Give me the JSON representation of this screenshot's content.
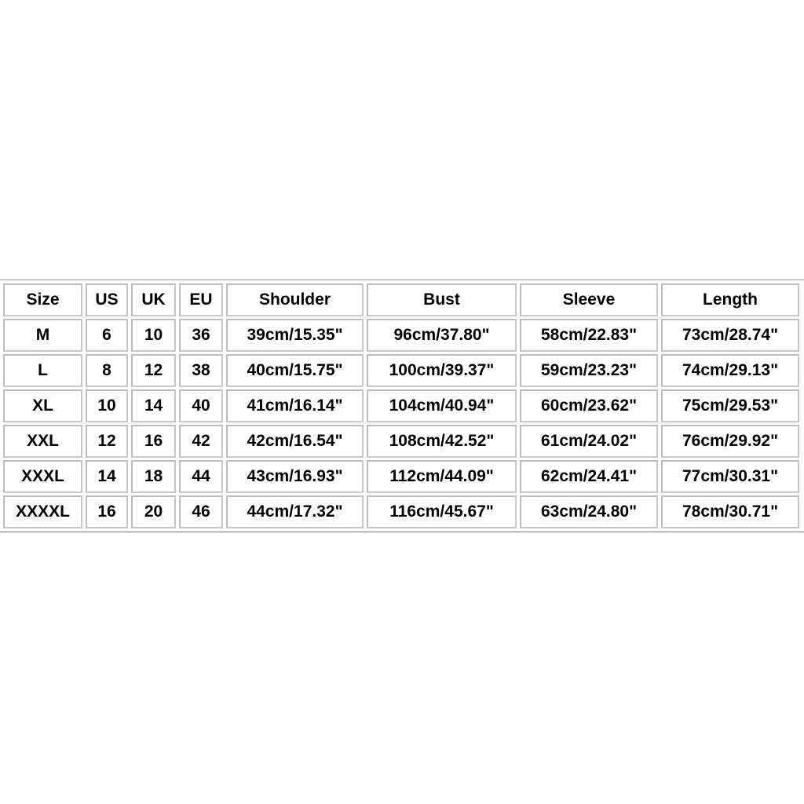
{
  "headers": [
    "Size",
    "US",
    "UK",
    "EU",
    "Shoulder",
    "Bust",
    "Sleeve",
    "Length"
  ],
  "rows": [
    [
      "M",
      "6",
      "10",
      "36",
      "39cm/15.35\"",
      "96cm/37.80\"",
      "58cm/22.83\"",
      "73cm/28.74\""
    ],
    [
      "L",
      "8",
      "12",
      "38",
      "40cm/15.75\"",
      "100cm/39.37\"",
      "59cm/23.23\"",
      "74cm/29.13\""
    ],
    [
      "XL",
      "10",
      "14",
      "40",
      "41cm/16.14\"",
      "104cm/40.94\"",
      "60cm/23.62\"",
      "75cm/29.53\""
    ],
    [
      "XXL",
      "12",
      "16",
      "42",
      "42cm/16.54\"",
      "108cm/42.52\"",
      "61cm/24.02\"",
      "76cm/29.92\""
    ],
    [
      "XXXL",
      "14",
      "18",
      "44",
      "43cm/16.93\"",
      "112cm/44.09\"",
      "62cm/24.41\"",
      "77cm/30.31\""
    ],
    [
      "XXXXL",
      "16",
      "20",
      "46",
      "44cm/17.32\"",
      "116cm/45.67\"",
      "63cm/24.80\"",
      "78cm/30.71\""
    ]
  ]
}
